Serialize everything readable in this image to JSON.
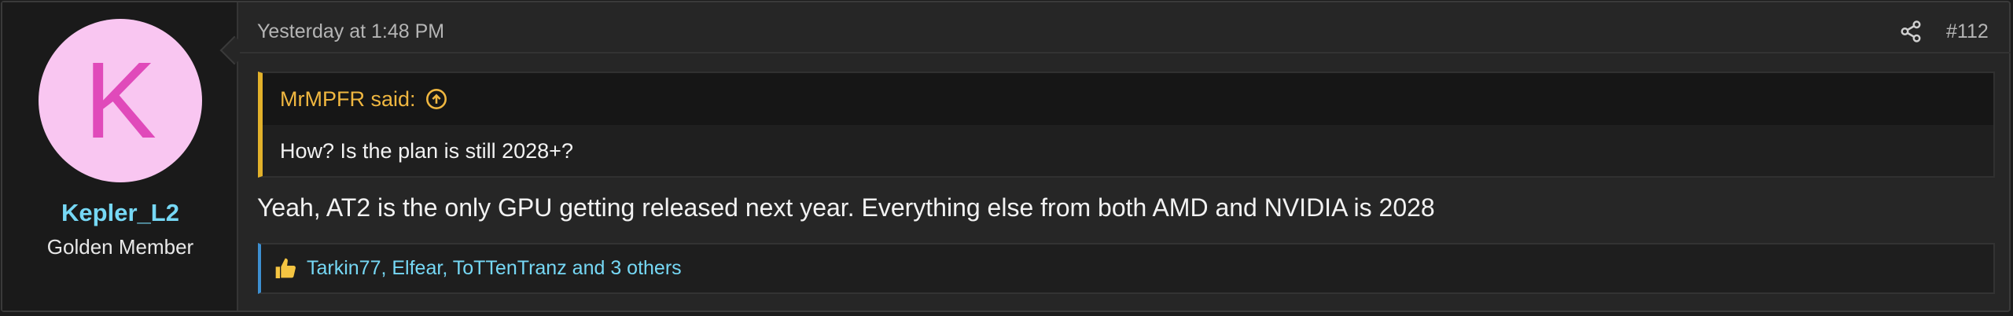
{
  "user": {
    "avatar_letter": "K",
    "avatar_bg": "#f9c6f1",
    "avatar_fg": "#e04aba",
    "name": "Kepler_L2",
    "title": "Golden Member"
  },
  "post": {
    "date": "Yesterday at 1:48 PM",
    "number": "#112",
    "quote": {
      "author": "MrMPFR said:",
      "text": "How? Is the plan is still 2028+?"
    },
    "message": "Yeah, AT2 is the only GPU getting released next year. Everything else from both AMD and NVIDIA is 2028",
    "reactions": "Tarkin77, Elfear, ToTTenTranz and 3 others"
  },
  "icons": {
    "share": "share-icon",
    "quote_jump": "arrow-up-circle-icon",
    "like": "thumbs-up-icon"
  },
  "colors": {
    "username": "#76d8f5",
    "quote_accent": "#e2b12a",
    "reaction_accent": "#3d8fd1"
  }
}
